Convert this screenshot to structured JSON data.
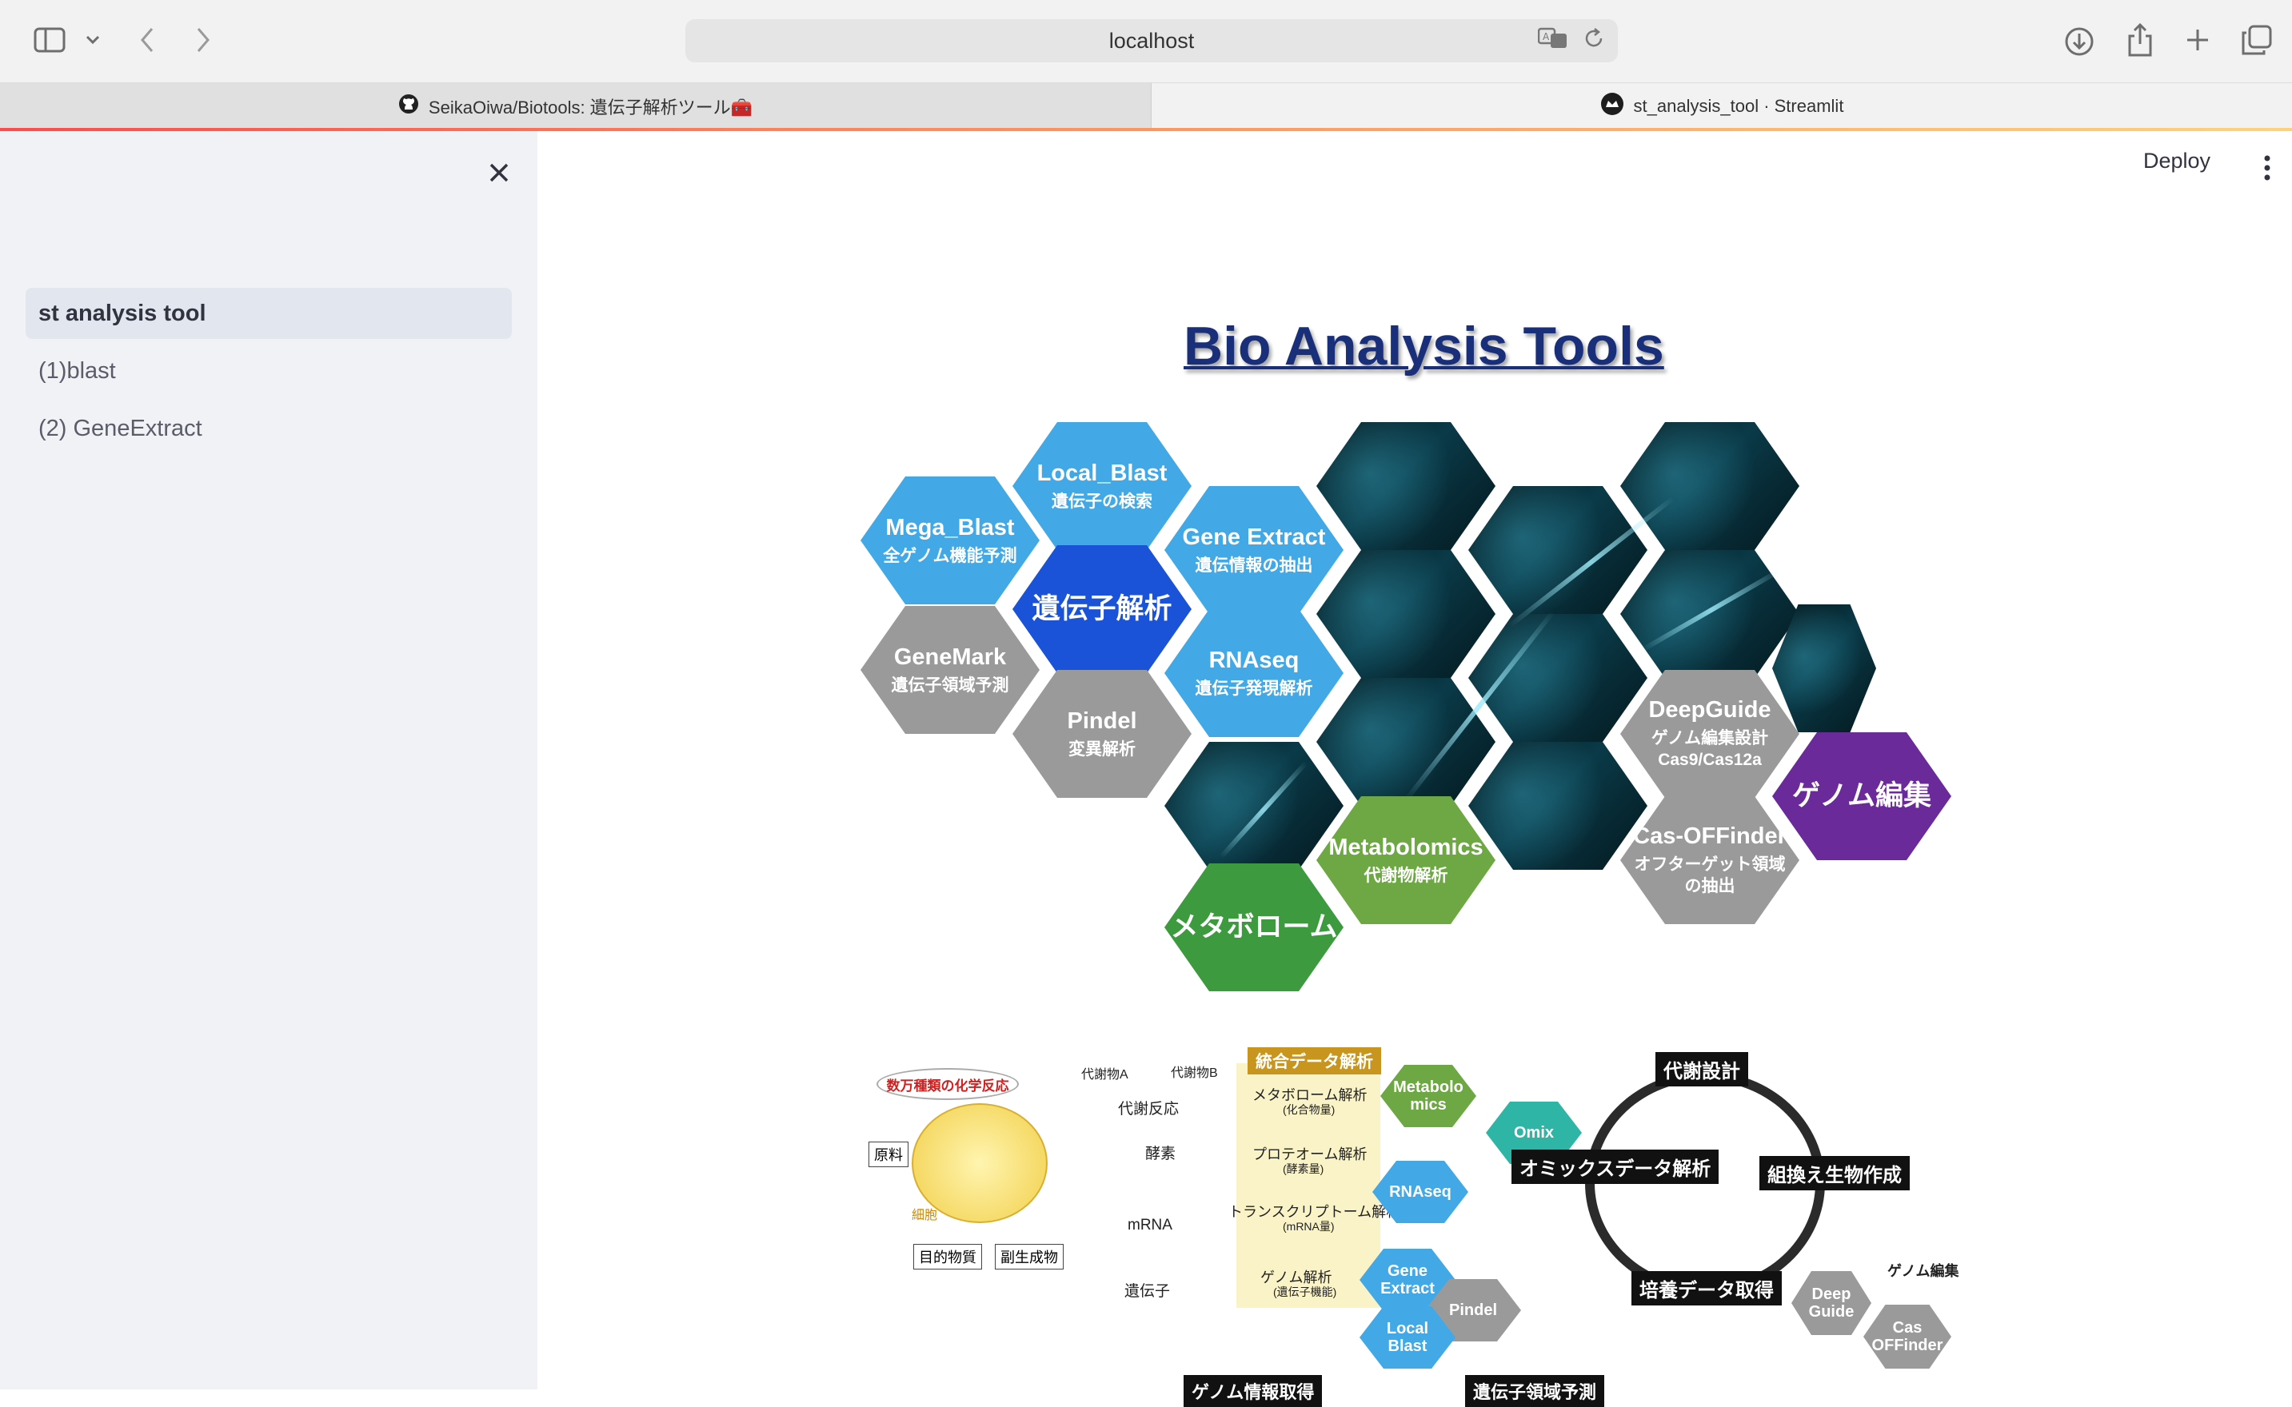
{
  "browser": {
    "url": "localhost",
    "tabs": [
      {
        "label": "SeikaOiwa/Biotools: 遺伝子解析ツール🧰",
        "active": false
      },
      {
        "label": "st_analysis_tool · Streamlit",
        "active": true
      }
    ]
  },
  "sidebar": {
    "items": [
      {
        "label": "st analysis tool",
        "selected": true
      },
      {
        "label": "(1)blast",
        "selected": false
      },
      {
        "label": "(2) GeneExtract",
        "selected": false
      }
    ]
  },
  "header": {
    "deploy_label": "Deploy"
  },
  "hero": {
    "title": "Bio Analysis Tools",
    "hexes": {
      "local_blast": {
        "t1": "Local_Blast",
        "t2": "遺伝子の検索"
      },
      "mega_blast": {
        "t1": "Mega_Blast",
        "t2": "全ゲノム機能予測"
      },
      "gene_extract": {
        "t1": "Gene Extract",
        "t2": "遺伝情報の抽出"
      },
      "gene_analysis": {
        "t1": "遺伝子解析"
      },
      "genemark": {
        "t1": "GeneMark",
        "t2": "遺伝子領域予測"
      },
      "rnaseq": {
        "t1": "RNAseq",
        "t2": "遺伝子発現解析"
      },
      "pindel": {
        "t1": "Pindel",
        "t2": "変異解析"
      },
      "deepguide": {
        "t1": "DeepGuide",
        "t2": "ゲノム編集設計",
        "t3": "Cas9/Cas12a"
      },
      "genome_edit": {
        "t1": "ゲノム編集"
      },
      "metabolomics": {
        "t1": "Metabolomics",
        "t2": "代謝物解析"
      },
      "cas_offinder": {
        "t1": "Cas-OFFinder",
        "t2": "オフターゲット領域",
        "t3": "の抽出"
      },
      "metabolome": {
        "t1": "メタボローム"
      }
    }
  },
  "diagram": {
    "reaction_bubble": "数万種類の化学反応",
    "raw_material": "原料",
    "cell": "細胞",
    "target": "目的物質",
    "byproduct": "副生成物",
    "metabolite_a": "代謝物A",
    "metabolite_b": "代謝物B",
    "metabolic_reaction": "代謝反応",
    "enzyme": "酵素",
    "mrna": "mRNA",
    "gene": "遺伝子",
    "integrated": "統合データ解析",
    "layers": [
      {
        "name": "メタボローム解析",
        "sub": "(化合物量)"
      },
      {
        "name": "プロテオーム解析",
        "sub": "(酵素量)"
      },
      {
        "name": "トランスクリプトーム解析",
        "sub": "(mRNA量)"
      },
      {
        "name": "ゲノム解析",
        "sub": "(遺伝子機能)"
      }
    ],
    "hex_metabolomics": "Metabolo\nmics",
    "hex_omix": "Omix",
    "hex_rnaseq": "RNAseq",
    "hex_gene_extract": "Gene\nExtract",
    "hex_pindel": "Pindel",
    "hex_local_blast": "Local\nBlast",
    "hex_deep_guide": "Deep\nGuide",
    "hex_cas_offinder": "Cas\nOFFinder",
    "cycle": {
      "design": "代謝設計",
      "omics": "オミックスデータ解析",
      "recomb": "組換え生物作成",
      "culture": "培養データ取得",
      "genome_edit": "ゲノム編集"
    },
    "bottom_left": "ゲノム情報取得",
    "bottom_right": "遺伝子領域予測"
  },
  "colors": {
    "accent": "#ff4b4b",
    "sidebar_bg": "#f0f2f6",
    "title": "#1a2f7a"
  }
}
